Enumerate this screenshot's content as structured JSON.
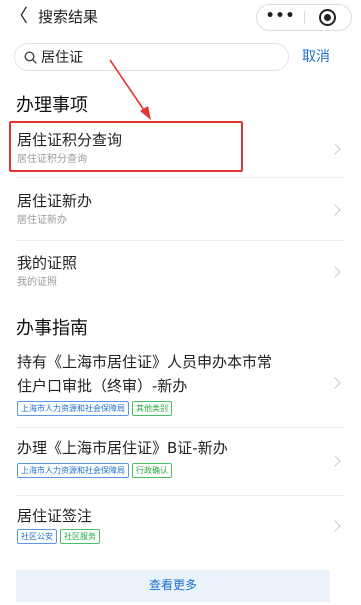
{
  "header": {
    "back_glyph": "〈",
    "title": "搜索结果",
    "more_glyph": "•••"
  },
  "search": {
    "value": "居住证",
    "cancel_label": "取消"
  },
  "section_tasks": {
    "title": "办理事项",
    "items": [
      {
        "title": "居住证积分查询",
        "subtitle": "居住证积分查询"
      },
      {
        "title": "居住证新办",
        "subtitle": "居住证新办"
      },
      {
        "title": "我的证照",
        "subtitle": "我的证照"
      }
    ]
  },
  "section_guides": {
    "title": "办事指南",
    "items": [
      {
        "title_line1": "持有《上海市居住证》人员申办本市常",
        "title_line2": "住户口审批（终审）-新办",
        "tags": [
          {
            "label": "上海市人力资源和社会保障局",
            "color": "blue"
          },
          {
            "label": "其他类别",
            "color": "green"
          }
        ]
      },
      {
        "title_line1": "办理《上海市居住证》B证-新办",
        "tags": [
          {
            "label": "上海市人力资源和社会保障局",
            "color": "blue"
          },
          {
            "label": "行政确认",
            "color": "green"
          }
        ]
      },
      {
        "title_line1": "居住证签注",
        "tags": [
          {
            "label": "社区公安",
            "color": "blue"
          },
          {
            "label": "社区服务",
            "color": "green"
          }
        ]
      }
    ]
  },
  "see_more_label": "查看更多",
  "colors": {
    "accent_blue": "#1f6fd1",
    "tag_green": "#27a844",
    "annotation_red": "#e53333"
  }
}
